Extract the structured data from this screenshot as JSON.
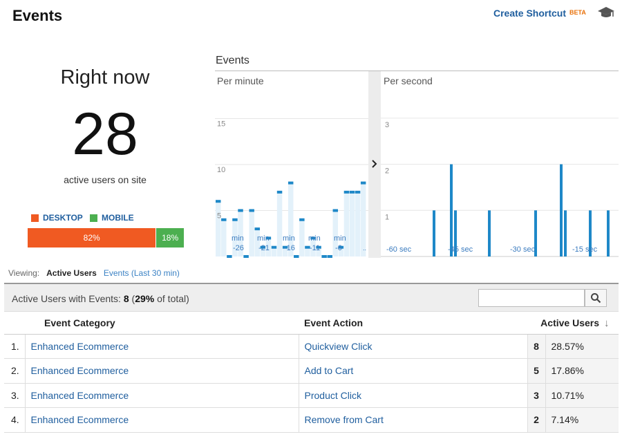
{
  "header": {
    "title": "Events",
    "shortcut_label": "Create Shortcut",
    "beta_label": "BETA",
    "help_icon": "graduation-cap-icon"
  },
  "right_now": {
    "title": "Right now",
    "count": "28",
    "subtitle": "active users on site",
    "legend": [
      {
        "label": "DESKTOP",
        "color": "#f05a22"
      },
      {
        "label": "MOBILE",
        "color": "#4caf50"
      }
    ],
    "desktop_pct": "82%",
    "mobile_pct": "18%"
  },
  "charts": {
    "section_title": "Events",
    "per_minute": {
      "title": "Per minute",
      "ylabels": [
        "15",
        "10",
        "5"
      ],
      "xlabels": [
        "-26",
        "-21",
        "-16",
        "-11",
        "-6"
      ],
      "unit_label": "min",
      "tail_label": "..",
      "values": [
        6,
        4,
        0,
        4,
        5,
        0,
        5,
        3,
        1,
        2,
        1,
        7,
        1,
        8,
        0,
        4,
        1,
        2,
        1,
        0,
        0,
        5,
        1,
        7,
        7,
        7,
        8
      ]
    },
    "per_second": {
      "title": "Per second",
      "ylabels": [
        "3",
        "2",
        "1"
      ],
      "xlabels": [
        "-60 sec",
        "-45 sec",
        "-30 sec",
        "-15 sec"
      ],
      "values": [
        1,
        2,
        1,
        1,
        1,
        2,
        1,
        1,
        1
      ]
    }
  },
  "viewing": {
    "label": "Viewing:",
    "active_tab": "Active Users",
    "other_tab": "Events (Last 30 min)"
  },
  "summary": {
    "prefix": "Active Users with Events:",
    "count": "8",
    "open_paren": "(",
    "pct": "29%",
    "suffix": "of total)"
  },
  "search": {
    "value": "",
    "icon": "search-icon"
  },
  "table": {
    "headers": {
      "category": "Event Category",
      "action": "Event Action",
      "users": "Active Users"
    },
    "rows": [
      {
        "num": "1.",
        "category": "Enhanced Ecommerce",
        "action": "Quickview Click",
        "count": "8",
        "pct": "28.57%"
      },
      {
        "num": "2.",
        "category": "Enhanced Ecommerce",
        "action": "Add to Cart",
        "count": "5",
        "pct": "17.86%"
      },
      {
        "num": "3.",
        "category": "Enhanced Ecommerce",
        "action": "Product Click",
        "count": "3",
        "pct": "10.71%"
      },
      {
        "num": "4.",
        "category": "Enhanced Ecommerce",
        "action": "Remove from Cart",
        "count": "2",
        "pct": "7.14%"
      }
    ]
  },
  "colors": {
    "accent_blue": "#1f5e9e",
    "bar_blue": "#1e88c8",
    "bar_light": "#e3f1fa"
  }
}
